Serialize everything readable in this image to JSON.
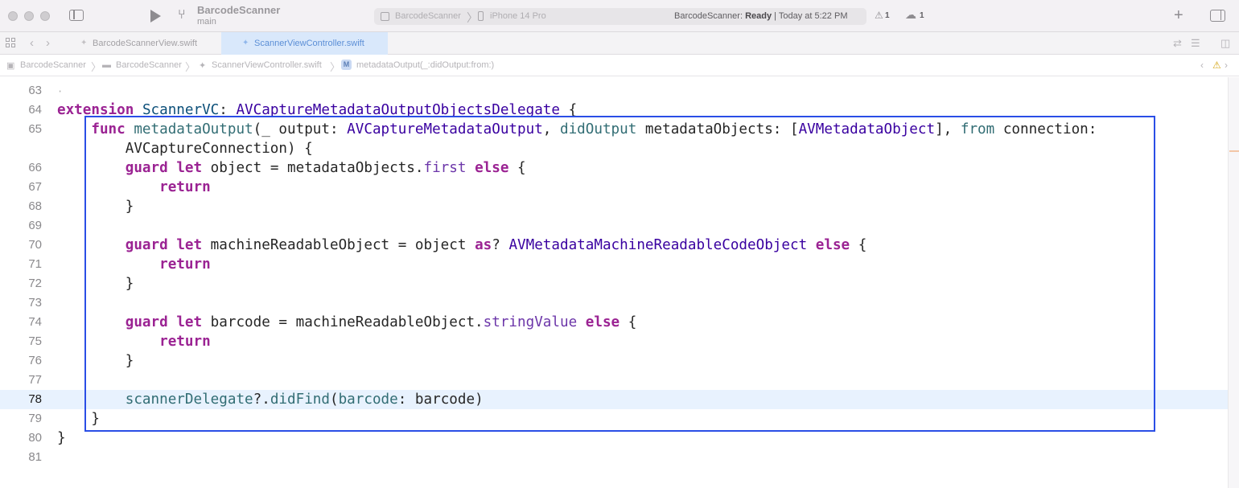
{
  "window": {
    "project_name": "BarcodeScanner",
    "branch": "main",
    "scheme": {
      "app": "BarcodeScanner",
      "device": "iPhone 14 Pro",
      "status_app": "BarcodeScanner:",
      "status_state": "Ready",
      "status_time": "| Today at 5:22 PM"
    },
    "warnings_count": "1",
    "cloud_issues_count": "1",
    "icons": [
      "sidebar-toggle-icon",
      "play-icon",
      "branch-icon",
      "warning-icon",
      "cloud-icon",
      "plus-icon",
      "inspector-toggle-icon"
    ]
  },
  "tabs": [
    {
      "label": "BarcodeScannerView.swift",
      "active": false
    },
    {
      "label": "ScannerViewController.swift",
      "active": true
    }
  ],
  "breadcrumb": {
    "items": [
      "BarcodeScanner",
      "BarcodeScanner",
      "ScannerViewController.swift",
      "metadataOutput(_:didOutput:from:)"
    ],
    "method_badge": "M"
  },
  "editor": {
    "current_line": 78,
    "line_numbers": [
      "63",
      "64",
      "65",
      "",
      "66",
      "67",
      "68",
      "69",
      "70",
      "71",
      "72",
      "73",
      "74",
      "75",
      "76",
      "77",
      "78",
      "79",
      "80",
      "81"
    ],
    "code_lines": [
      [],
      [
        {
          "t": "extension",
          "c": "kw"
        },
        {
          "t": " "
        },
        {
          "t": "ScannerVC",
          "c": "tp"
        },
        {
          "t": ": "
        },
        {
          "t": "AVCaptureMetadataOutputObjectsDelegate",
          "c": "ty"
        },
        {
          "t": " {"
        }
      ],
      [
        {
          "t": "    "
        },
        {
          "t": "func",
          "c": "kw"
        },
        {
          "t": " "
        },
        {
          "t": "metadataOutput",
          "c": "fn"
        },
        {
          "t": "(_ output: "
        },
        {
          "t": "AVCaptureMetadataOutput",
          "c": "ty"
        },
        {
          "t": ", "
        },
        {
          "t": "didOutput",
          "c": "fn"
        },
        {
          "t": " metadataObjects: ["
        },
        {
          "t": "AVMetadataObject",
          "c": "ty"
        },
        {
          "t": "], "
        },
        {
          "t": "from",
          "c": "fn"
        },
        {
          "t": " connection:"
        }
      ],
      [
        {
          "t": "        AVCaptureConnection) {"
        }
      ],
      [
        {
          "t": "        "
        },
        {
          "t": "guard",
          "c": "kw"
        },
        {
          "t": " "
        },
        {
          "t": "let",
          "c": "kw"
        },
        {
          "t": " object = metadataObjects."
        },
        {
          "t": "first",
          "c": "pl"
        },
        {
          "t": " "
        },
        {
          "t": "else",
          "c": "kw"
        },
        {
          "t": " {"
        }
      ],
      [
        {
          "t": "            "
        },
        {
          "t": "return",
          "c": "kw"
        }
      ],
      [
        {
          "t": "        }"
        }
      ],
      [],
      [
        {
          "t": "        "
        },
        {
          "t": "guard",
          "c": "kw"
        },
        {
          "t": " "
        },
        {
          "t": "let",
          "c": "kw"
        },
        {
          "t": " machineReadableObject = object "
        },
        {
          "t": "as",
          "c": "kw"
        },
        {
          "t": "? "
        },
        {
          "t": "AVMetadataMachineReadableCodeObject",
          "c": "ty"
        },
        {
          "t": " "
        },
        {
          "t": "else",
          "c": "kw"
        },
        {
          "t": " {"
        }
      ],
      [
        {
          "t": "            "
        },
        {
          "t": "return",
          "c": "kw"
        }
      ],
      [
        {
          "t": "        }"
        }
      ],
      [],
      [
        {
          "t": "        "
        },
        {
          "t": "guard",
          "c": "kw"
        },
        {
          "t": " "
        },
        {
          "t": "let",
          "c": "kw"
        },
        {
          "t": " barcode = machineReadableObject."
        },
        {
          "t": "stringValue",
          "c": "pl"
        },
        {
          "t": " "
        },
        {
          "t": "else",
          "c": "kw"
        },
        {
          "t": " {"
        }
      ],
      [
        {
          "t": "            "
        },
        {
          "t": "return",
          "c": "kw"
        }
      ],
      [
        {
          "t": "        }"
        }
      ],
      [],
      [
        {
          "t": "        "
        },
        {
          "t": "scannerDelegate",
          "c": "fn"
        },
        {
          "t": "?."
        },
        {
          "t": "didFind",
          "c": "fn"
        },
        {
          "t": "("
        },
        {
          "t": "barcode",
          "c": "fn"
        },
        {
          "t": ": barcode)"
        }
      ],
      [
        {
          "t": "    }"
        }
      ],
      [
        {
          "t": "}"
        }
      ],
      []
    ],
    "colors": {
      "keyword": "#9b2393",
      "type": "#3900a0",
      "project_type": "#0b4f79",
      "function": "#326d74",
      "property": "#6c36a9",
      "highlight_box": "#2a4ee6",
      "current_line_bg": "#e8f2fe"
    }
  }
}
